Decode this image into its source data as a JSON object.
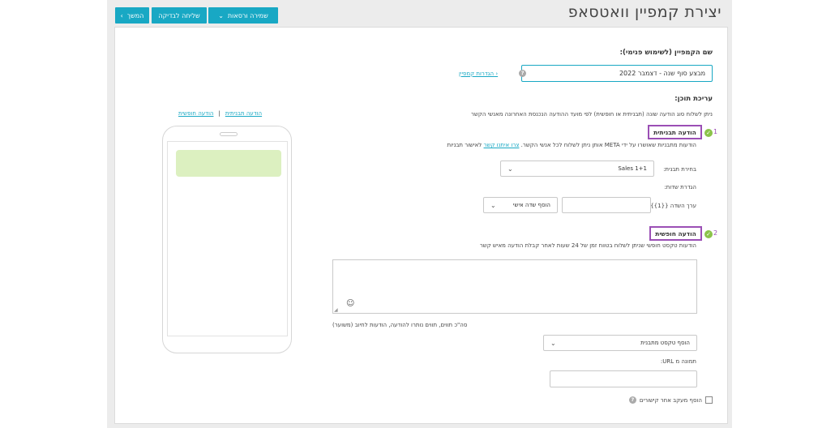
{
  "page": {
    "title": "יצירת קמפיין וואטסאפ"
  },
  "toolbar": {
    "save_label": "שמירה ורסאות",
    "test_label": "שליחה לבדיקה",
    "next_label": "המשך"
  },
  "campaign": {
    "name_label": "שם הקמפיין (לשימוש פנימי):",
    "name_value": "מבצע סוף שנה - דצמבר 2022",
    "settings_link": "הגדרות קמפיין"
  },
  "content": {
    "heading": "עריכת תוכן:",
    "description": "ניתן לשלוח סוג הודעה שונה (תבניתית או חופשית) לפי מועד ההודעה הנכנסת האחרונה מאנשי הקשר"
  },
  "template_msg": {
    "number": "1",
    "title": "הודעה תבניתית",
    "desc_prefix": "הודעות מתבניות שאושרו על ידי META אותן ניתן לשלוח לכל אנשי הקשר.",
    "desc_link": "צרו איתנו קשר",
    "desc_suffix": "לאישור תבניות",
    "template_select_label": "בחירת תבנית:",
    "template_select_value": "Sales 1+1",
    "fields_label": "הגדרת שדות:",
    "field_value_label": "ערך השדה {{1}}",
    "field_value": "",
    "personal_field_label": "הוסף שדה אישי"
  },
  "free_msg": {
    "number": "2",
    "title": "הודעה חופשית",
    "desc": "הודעות טקסט חופשי שניתן לשלוח בטווח זמן של 24 שעות לאחר קבלת הודעה מאיש קשר",
    "text_value": "",
    "counter_text": "סה\"כ  תווים,  תווים נותרו להודעה,  הודעות לחיוב (משוער)",
    "add_template_text": "הוסף טקסט מתבנית",
    "image_url_label": "תמונה מ URL:",
    "image_url_value": "",
    "tracking_label": "הוסף מעקב אחר קישורים"
  },
  "preview": {
    "tab_template": "הודעה תבניתית",
    "separator": "|",
    "tab_free": "הודעה חופשית"
  }
}
